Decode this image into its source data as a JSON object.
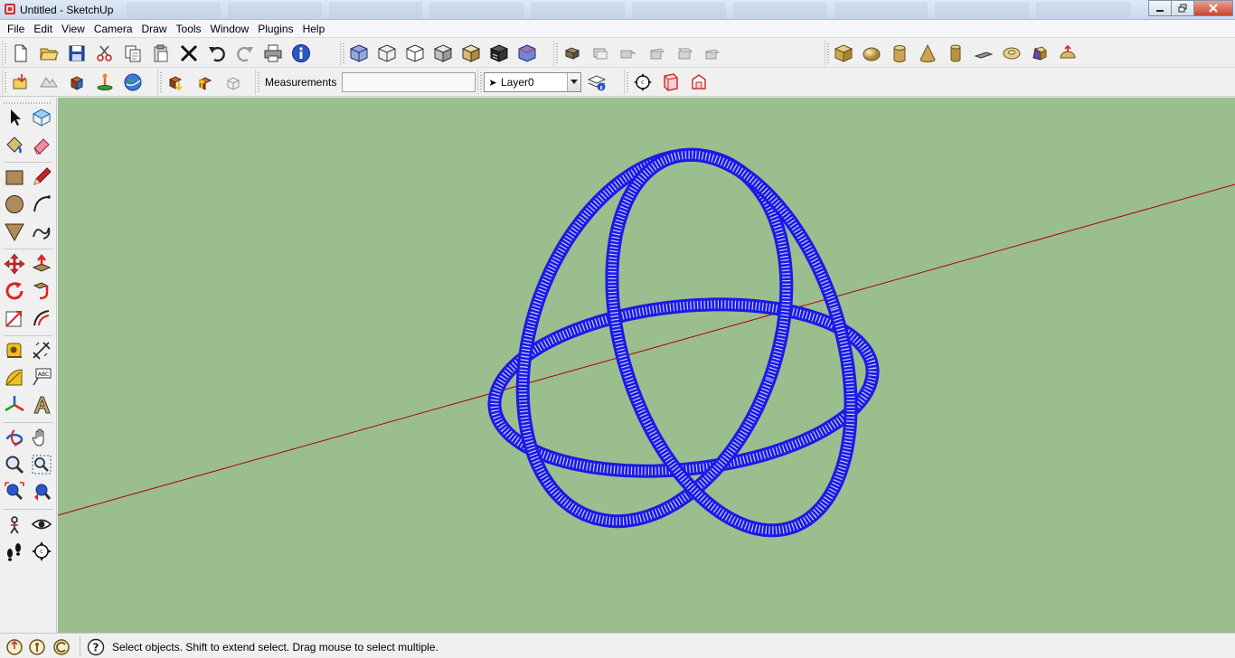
{
  "window": {
    "title": "Untitled - SketchUp"
  },
  "menu": [
    "File",
    "Edit",
    "View",
    "Camera",
    "Draw",
    "Tools",
    "Window",
    "Plugins",
    "Help"
  ],
  "measurements": {
    "label": "Measurements",
    "value": ""
  },
  "layer": {
    "selected": "Layer0"
  },
  "status": {
    "message": "Select objects. Shift to extend select. Drag mouse to select multiple."
  },
  "colors": {
    "viewport_bg": "#9abe8e",
    "model_blue": "#1a1ae6",
    "red_axis": "#b00000"
  },
  "icons": {
    "standard_toolbar": [
      "new-icon",
      "open-icon",
      "save-icon",
      "cut-icon",
      "copy-icon",
      "paste-icon",
      "erase-icon",
      "undo-icon",
      "redo-icon",
      "print-icon",
      "model-info-icon"
    ],
    "style_toolbar": [
      "xray-icon",
      "wireframe-icon",
      "hidden-line-icon",
      "shaded-icon",
      "shaded-textures-icon",
      "monochrome-icon"
    ],
    "section_toolbar": [
      "section-plane-icon"
    ],
    "views_toolbar": [
      "iso-view-icon",
      "top-view-icon",
      "front-view-icon",
      "right-view-icon",
      "back-view-icon"
    ],
    "shapes_toolbar": [
      "box-icon",
      "sphere-icon",
      "cylinder-icon",
      "cone-icon",
      "tube-icon",
      "plane-icon",
      "torus-icon",
      "helix-icon",
      "dome-icon"
    ]
  }
}
